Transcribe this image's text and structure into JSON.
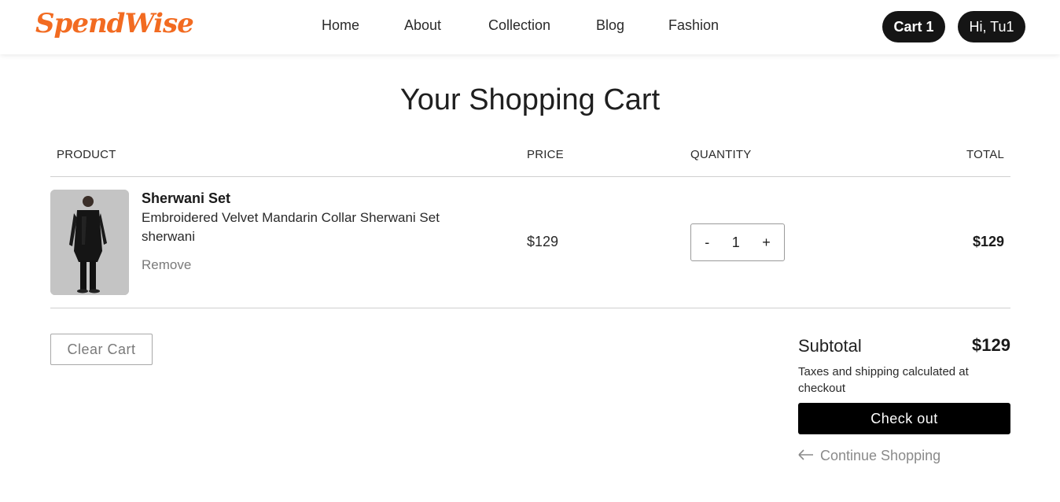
{
  "header": {
    "logo": "SpendWise",
    "nav": [
      "Home",
      "About",
      "Collection",
      "Blog",
      "Fashion"
    ],
    "cart_label": "Cart 1",
    "user_label": "Hi, Tu1"
  },
  "page": {
    "title": "Your Shopping Cart"
  },
  "table": {
    "columns": [
      "PRODUCT",
      "PRICE",
      "QUANTITY",
      "TOTAL"
    ],
    "items": [
      {
        "name": "Sherwani Set",
        "description": "Embroidered Velvet Mandarin Collar Sherwani Set",
        "category": "sherwani",
        "remove_label": "Remove",
        "price": "$129",
        "quantity": "1",
        "decrement": "-",
        "increment": "+",
        "total": "$129"
      }
    ]
  },
  "footer": {
    "clear_label": "Clear Cart",
    "subtotal_label": "Subtotal",
    "subtotal_value": "$129",
    "tax_note": "Taxes and shipping calculated at checkout",
    "checkout_label": "Check out",
    "continue_label": "Continue Shopping"
  },
  "colors": {
    "brand": "#f26b21",
    "dark": "#151515"
  }
}
